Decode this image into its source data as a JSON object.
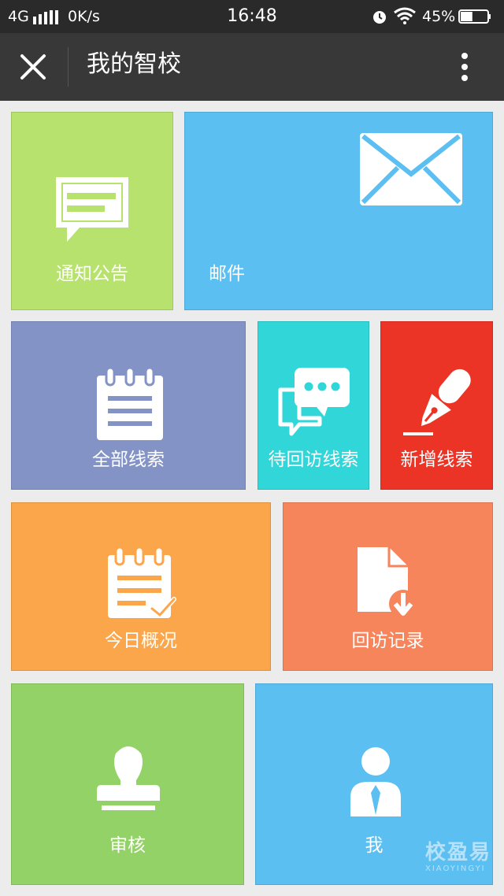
{
  "status_bar": {
    "network": "4G",
    "speed": "0K/s",
    "time": "16:48",
    "battery": "45%",
    "battery_level": 0.45
  },
  "nav": {
    "title": "我的智校",
    "close_icon": "close-icon",
    "more_icon": "more-vertical-icon"
  },
  "tiles": [
    {
      "label": "通知公告",
      "color": "#b7e26d",
      "icon": "message-icon"
    },
    {
      "label": "邮件",
      "color": "#5bbff1",
      "icon": "envelope-icon"
    },
    {
      "label": "全部线索",
      "color": "#8493c6",
      "icon": "notepad-icon"
    },
    {
      "label": "待回访线索",
      "color": "#31d6d8",
      "icon": "chat-bubble-icon"
    },
    {
      "label": "新增线索",
      "color": "#ec3426",
      "icon": "pen-icon"
    },
    {
      "label": "今日概况",
      "color": "#fba64a",
      "icon": "checklist-icon"
    },
    {
      "label": "回访记录",
      "color": "#f6855c",
      "icon": "document-download-icon"
    },
    {
      "label": "审核",
      "color": "#93d266",
      "icon": "stamp-icon"
    },
    {
      "label": "我",
      "color": "#5bbff1",
      "icon": "user-icon"
    }
  ],
  "watermark": {
    "text_cn": "校盈易",
    "text_en": "XIAOYINGYI"
  }
}
